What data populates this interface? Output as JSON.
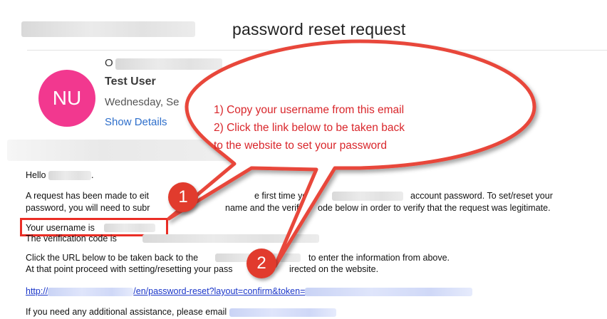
{
  "email": {
    "subject": "password reset request",
    "sender_initial": "O",
    "avatar_initials": "NU",
    "sender_name": "Test User",
    "date_prefix": "Wednesday, Se",
    "show_details_label": "Show Details"
  },
  "body": {
    "greeting": "Hello",
    "greeting_punct": ".",
    "request_line1_a": "A request has been made to eit",
    "request_line1_b": "e first time yo",
    "request_line1_c": "account password. To set/reset your",
    "request_line2_a": "password, you will need to subr",
    "request_line2_b": "name and the verific",
    "request_line2_c": "ode below in order to verify that the request was legitimate.",
    "username_label": "Your username is",
    "verification_label": "The verification code is",
    "click_line1_a": "Click the URL below to be taken back to the",
    "click_line1_b": "to enter the information from above.",
    "click_line2_a": "At that point proceed with setting/resetting your pass",
    "click_line2_b": "irected on the website.",
    "link_prefix": "http://",
    "link_path": "/en/password-reset?layout=confirm&token=",
    "assistance": "If you need any additional assistance, please email"
  },
  "annotations": {
    "callout_line1": "1) Copy your username from this email",
    "callout_line2": "2) Click the link below to be taken back",
    "callout_line3": "to the website to set your password",
    "badge_1": "1",
    "badge_2": "2",
    "accent_color": "#e13b2d"
  }
}
